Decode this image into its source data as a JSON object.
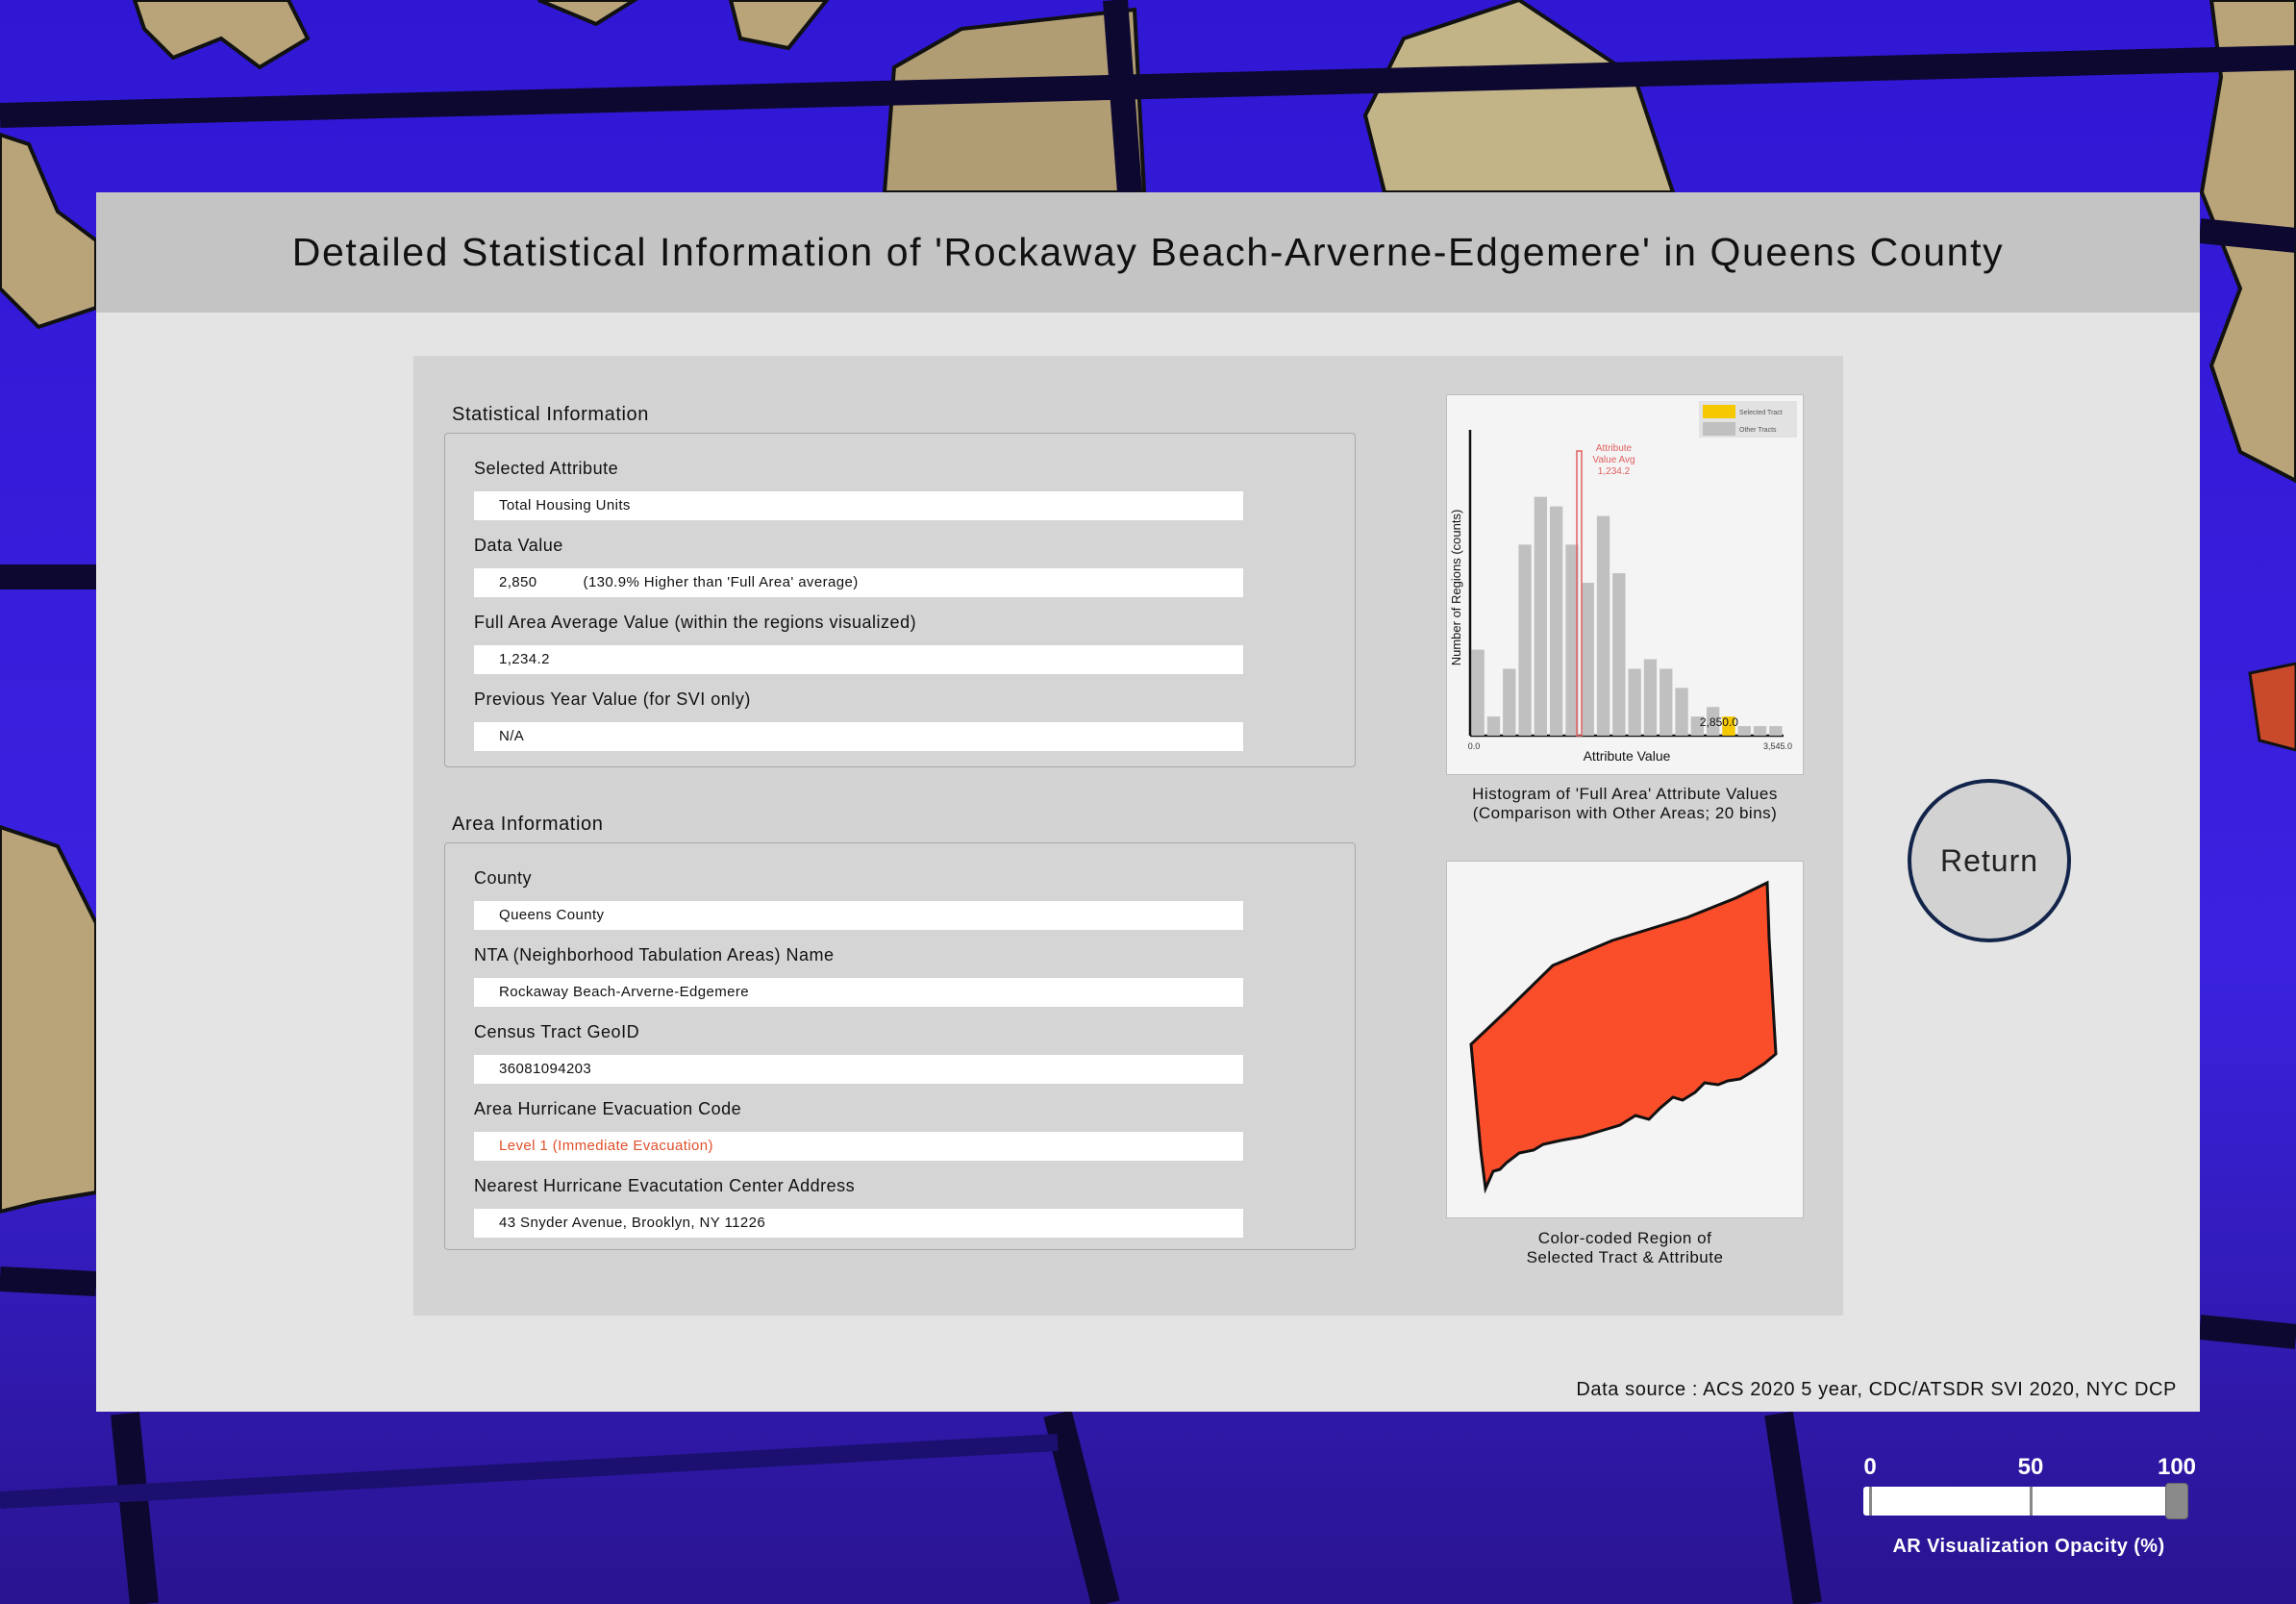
{
  "title": "Detailed Statistical Information of 'Rockaway Beach-Arverne-Edgemere' in Queens County",
  "statistical": {
    "heading": "Statistical Information",
    "fields": [
      {
        "label": "Selected Attribute",
        "value": "Total Housing Units"
      },
      {
        "label": "Data Value",
        "value": "2,850",
        "note": "(130.9% Higher than 'Full Area' average)"
      },
      {
        "label": "Full Area Average Value (within the regions visualized)",
        "value": "1,234.2"
      },
      {
        "label": "Previous Year Value (for SVI only)",
        "value": "N/A"
      }
    ]
  },
  "area": {
    "heading": "Area Information",
    "fields": [
      {
        "label": "County",
        "value": "Queens County"
      },
      {
        "label": "NTA (Neighborhood Tabulation Areas) Name",
        "value": "Rockaway Beach-Arverne-Edgemere"
      },
      {
        "label": "Census Tract GeoID",
        "value": "36081094203"
      },
      {
        "label": "Area Hurricane Evacuation Code",
        "value": "Level 1 (Immediate Evacuation)",
        "value_color": "#e0502a"
      },
      {
        "label": "Nearest Hurricane Evacutation Center Address",
        "value": "43 Snyder Avenue, Brooklyn, NY 11226"
      }
    ]
  },
  "chart_data": {
    "type": "bar",
    "title": "",
    "xlabel": "Attribute Value",
    "ylabel": "Number of Regions (counts)",
    "xlim": [
      0.0,
      3545.0
    ],
    "x_tick_labels": [
      "0.0",
      "3,545.0"
    ],
    "bins": 20,
    "values": [
      9,
      2,
      7,
      20,
      25,
      24,
      20,
      16,
      23,
      17,
      7,
      8,
      7,
      5,
      2,
      3,
      2,
      1,
      1,
      1
    ],
    "selected_bin_index": 16,
    "avg_line": {
      "value": 1234.2,
      "label_lines": [
        "Attribute",
        "Value Avg",
        "1,234.2"
      ],
      "color": "#e06060"
    },
    "selected_marker_label": "2,850.0",
    "legend": [
      {
        "name": "Selected Tract",
        "color": "#f5c800"
      },
      {
        "name": "Other Tracts",
        "color": "#c0c0c0"
      }
    ],
    "legend_position": "top-right",
    "grid": false
  },
  "histogram_caption": [
    "Histogram of 'Full Area' Attribute Values",
    "(Comparison with Other Areas; 20 bins)"
  ],
  "region_caption": [
    "Color-coded Region of",
    "Selected Tract & Attribute"
  ],
  "region_color": "#fa4d2a",
  "data_source": "Data source : ACS 2020 5 year, CDC/ATSDR SVI 2020, NYC DCP",
  "return_label": "Return",
  "opacity_slider": {
    "ticks": [
      "0",
      "50",
      "100"
    ],
    "value": 100,
    "caption": "AR Visualization Opacity (%)"
  },
  "colors": {
    "background_blue": "#3a1fd8",
    "map_tan": "#b8a478",
    "panel": "#e4e4e4",
    "title_bar": "#c4c4c4",
    "return_border": "#13244a"
  }
}
